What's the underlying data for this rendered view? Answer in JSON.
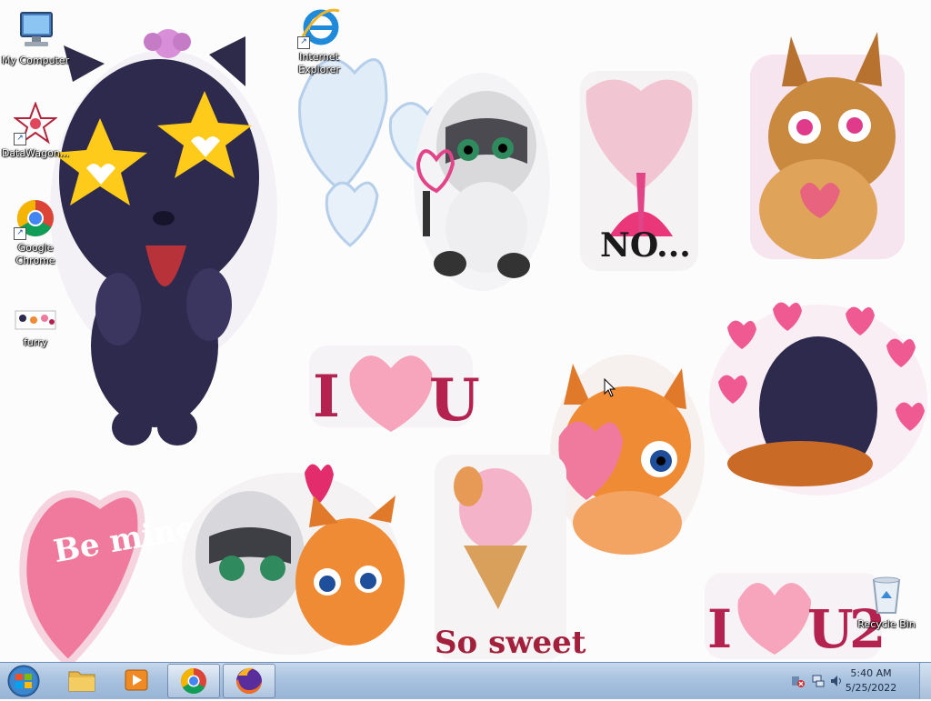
{
  "desktop": {
    "icons": [
      {
        "label": "My Computer",
        "icon": "computer-icon"
      },
      {
        "label": "Internet Explorer",
        "icon": "internet-explorer-icon"
      },
      {
        "label": "DataWagon...",
        "icon": "datawagon-icon"
      },
      {
        "label": "Google Chrome",
        "icon": "chrome-icon"
      },
      {
        "label": "furry",
        "icon": "image-file-icon"
      },
      {
        "label": "Recycle Bin",
        "icon": "recycle-bin-icon"
      }
    ],
    "stickers": {
      "no_text": "NO...",
      "i_love_u_left": "I",
      "i_love_u_right": "U",
      "be_mine": "Be mine",
      "so_sweet": "So sweet",
      "i_love_u2_i": "I",
      "i_love_u2_u": "U",
      "i_love_u2_2": "2"
    }
  },
  "taskbar": {
    "buttons": [
      {
        "name": "start-button",
        "icon": "windows-logo-icon"
      },
      {
        "name": "explorer",
        "icon": "folder-icon"
      },
      {
        "name": "media-player",
        "icon": "media-player-icon"
      },
      {
        "name": "chrome",
        "icon": "chrome-icon"
      },
      {
        "name": "firefox",
        "icon": "firefox-icon"
      }
    ],
    "clock": {
      "time": "5:40 AM",
      "date": "5/25/2022"
    }
  }
}
